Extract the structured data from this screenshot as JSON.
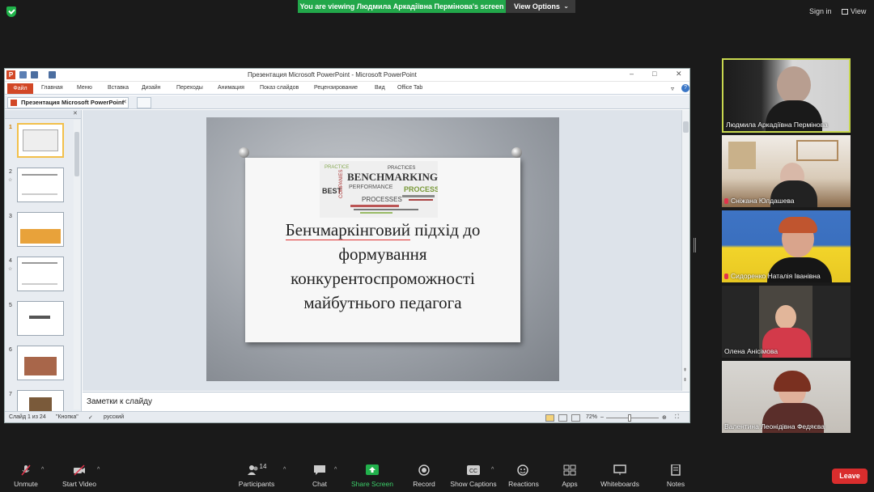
{
  "zoom": {
    "banner": "You are viewing Людмила Аркадіївна Пермінова's screen",
    "view_options": "View Options",
    "sign_in": "Sign in",
    "view": "View"
  },
  "ppt": {
    "window_title": "Презентация Microsoft PowerPoint  -  Microsoft PowerPoint",
    "ribbon_tabs": [
      "Файл",
      "Главная",
      "Меню",
      "Вставка",
      "Дизайн",
      "Переходы",
      "Анимация",
      "Показ слайдов",
      "Рецензирование",
      "Вид",
      "Office Tab"
    ],
    "doc_tab": "Презентация Microsoft PowerPoint",
    "thumbs": [
      "1",
      "2",
      "3",
      "4",
      "5",
      "6",
      "7"
    ],
    "slide": {
      "line1": "Бенчмаркінговий",
      "line1b": " підхід до",
      "line2": "формування",
      "line3": "конкурентоспроможності",
      "line4": "майбутнього педагога",
      "cloud_words": [
        "BENCHMARKING",
        "BEST",
        "PROCESS",
        "PRACTICES",
        "COMPANIES",
        "PERFORMANCE",
        "PROCESSES",
        "PRACTICE"
      ]
    },
    "notes_placeholder": "Заметки к слайду",
    "status": {
      "slide": "Слайд 1 из 24",
      "theme": "\"Кнопка\"",
      "lang": "русский",
      "zoom": "72%"
    }
  },
  "participants": [
    {
      "name": "Людмила Аркадіївна Пермінова",
      "muted": false
    },
    {
      "name": "Сніжана Юлдашева",
      "muted": true
    },
    {
      "name": "Сидоренко Наталія Іванівна",
      "muted": true
    },
    {
      "name": "Олена Анісімова",
      "muted": false
    },
    {
      "name": "Валентина Леонідівна Федяєва",
      "muted": false
    }
  ],
  "toolbar": {
    "unmute": "Unmute",
    "start_video": "Start Video",
    "participants": "Participants",
    "participants_count": "14",
    "chat": "Chat",
    "share_screen": "Share Screen",
    "record": "Record",
    "captions": "Show Captions",
    "reactions": "Reactions",
    "apps": "Apps",
    "whiteboards": "Whiteboards",
    "notes": "Notes",
    "leave": "Leave"
  },
  "colors": {
    "zoom_green": "#22a74a",
    "leave_red": "#d92d2d",
    "ppt_orange": "#d24726",
    "active_speaker": "#c8d84f"
  }
}
